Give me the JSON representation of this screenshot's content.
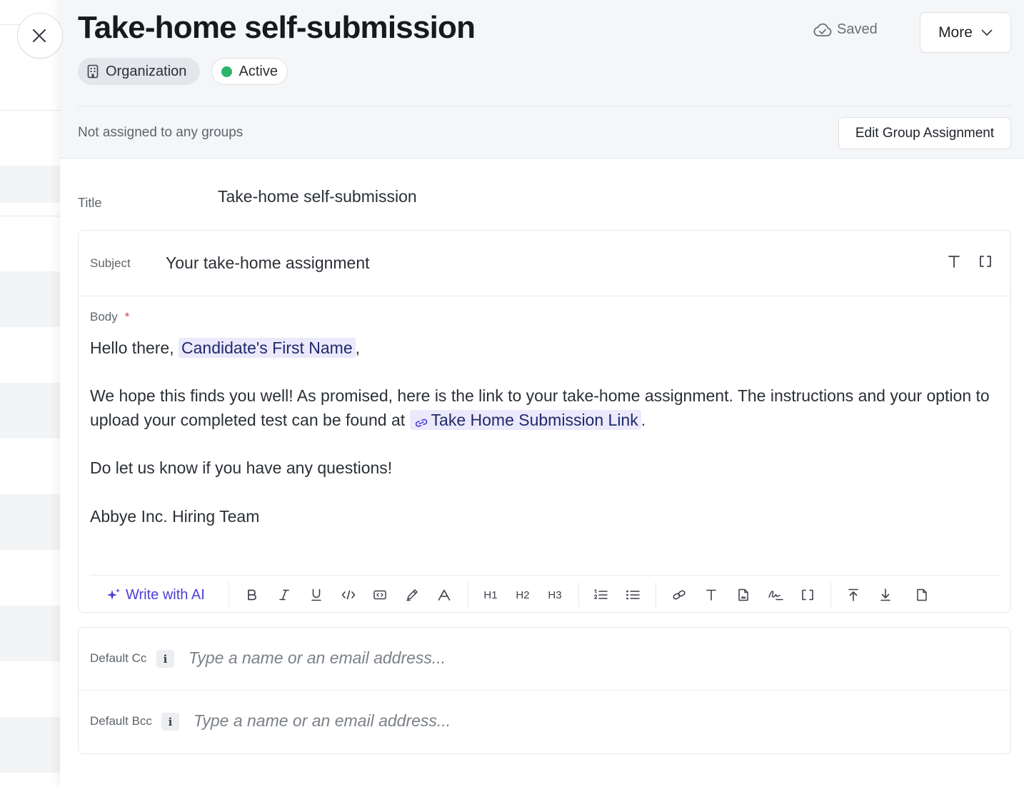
{
  "header": {
    "title": "Take-home self-submission",
    "org_chip": "Organization",
    "status_chip": "Active",
    "status_color": "#2fb369",
    "saved_label": "Saved",
    "more_label": "More",
    "groups_text": "Not assigned to any groups",
    "edit_group_label": "Edit Group Assignment"
  },
  "form": {
    "title_label": "Title",
    "title_value": "Take-home self-submission",
    "subject_label": "Subject",
    "subject_value": "Your take-home assignment",
    "body_label": "Body",
    "body_required": "*",
    "body": {
      "greeting": "Hello there,",
      "first_name_var": "Candidate's First Name",
      "greeting_end": ",",
      "para1": "We hope this finds you well! As promised, here is the link to your take-home assignment. The instructions and your option to upload your completed test can be found at",
      "link_var": "Take Home Submission Link",
      "para1_end": ".",
      "para2": "Do let us know if you have any questions!",
      "signature": "Abbye Inc. Hiring Team"
    },
    "toolbar": {
      "ai_label": "Write with AI",
      "accent": "#4b3fd4",
      "h1": "H1",
      "h2": "H2",
      "h3": "H3"
    },
    "cc_label": "Default Cc",
    "bcc_label": "Default Bcc",
    "info_glyph": "i",
    "cc_placeholder": "Type a name or an email address...",
    "bcc_placeholder": "Type a name or an email address..."
  }
}
